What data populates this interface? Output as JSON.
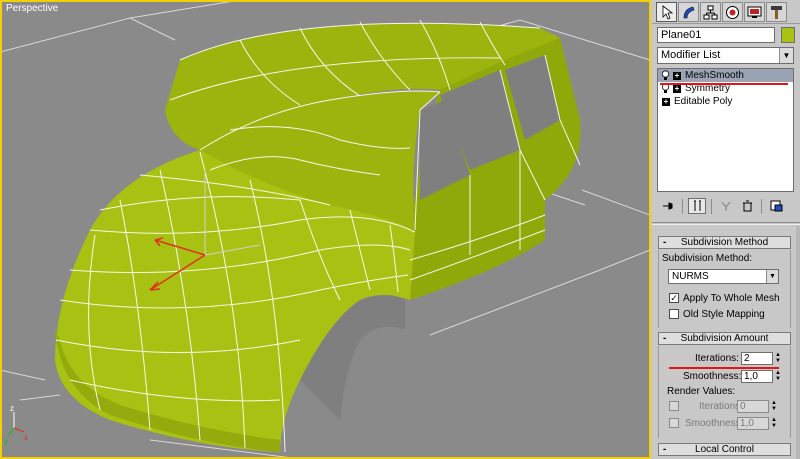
{
  "viewport": {
    "label": "Perspective",
    "mesh_color": "#a8c213",
    "wire_color": "#ffffff",
    "frame_color": "#f5d000"
  },
  "panel": {
    "object_name": "Plane01",
    "object_color": "#a8c213",
    "modifier_list": "Modifier List",
    "stack": [
      {
        "label": "MeshSmooth",
        "selected": true
      },
      {
        "label": "Symmetry",
        "selected": false
      },
      {
        "label": "Editable Poly",
        "selected": false
      }
    ],
    "subdivision_method": {
      "title": "Subdivision Method",
      "method_label": "Subdivision Method:",
      "method_value": "NURMS",
      "apply_whole_mesh": "Apply To Whole Mesh",
      "old_style_mapping": "Old Style Mapping"
    },
    "subdivision_amount": {
      "title": "Subdivision Amount",
      "iterations_label": "Iterations:",
      "iterations_value": "2",
      "smoothness_label": "Smoothness:",
      "smoothness_value": "1,0",
      "render_values": "Render Values:",
      "render_iterations_label": "Iterations:",
      "render_iterations_value": "0",
      "render_smoothness_label": "Smoothness:",
      "render_smoothness_value": "1,0"
    },
    "local_control": {
      "title": "Local Control"
    },
    "collapse_symbol": "-",
    "highlight_color": "#e31414"
  }
}
